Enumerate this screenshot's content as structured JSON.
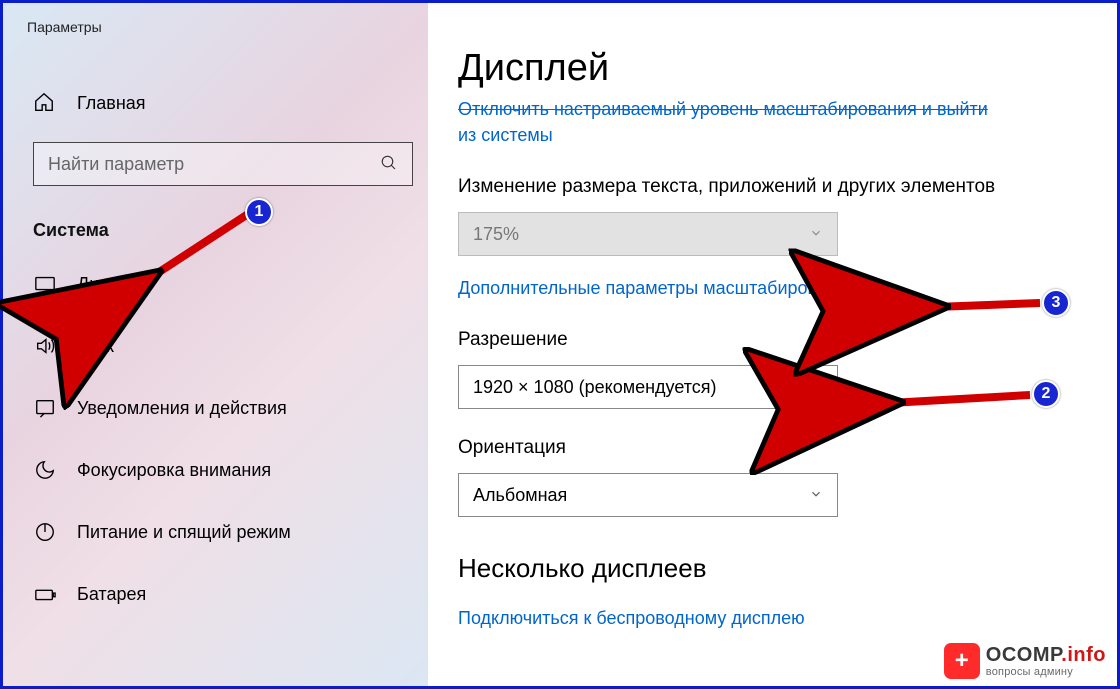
{
  "app_title": "Параметры",
  "sidebar": {
    "home_label": "Главная",
    "search_placeholder": "Найти параметр",
    "section_label": "Система",
    "items": [
      {
        "icon": "display",
        "label": "Дисплей"
      },
      {
        "icon": "sound",
        "label": "Звук"
      },
      {
        "icon": "notifications",
        "label": "Уведомления и действия"
      },
      {
        "icon": "focus",
        "label": "Фокусировка внимания"
      },
      {
        "icon": "power",
        "label": "Питание и спящий режим"
      },
      {
        "icon": "battery",
        "label": "Батарея"
      }
    ]
  },
  "main": {
    "page_title": "Дисплей",
    "clipped_link_line1": "Отключить настраиваемый уровень масштабирования и выйти",
    "clipped_link_line2": "из системы",
    "scaling_label": "Изменение размера текста, приложений и других элементов",
    "scaling_value": "175%",
    "advanced_scaling_link": "Дополнительные параметры масштабирования",
    "resolution_label": "Разрешение",
    "resolution_value": "1920 × 1080 (рекомендуется)",
    "orientation_label": "Ориентация",
    "orientation_value": "Альбомная",
    "multi_display_heading": "Несколько дисплеев",
    "wireless_display_link": "Подключиться к беспроводному дисплею"
  },
  "annotations": {
    "badge1": "1",
    "badge2": "2",
    "badge3": "3"
  },
  "watermark": {
    "brand": "OCOMP",
    "tld": ".info",
    "subtitle": "вопросы админу"
  }
}
